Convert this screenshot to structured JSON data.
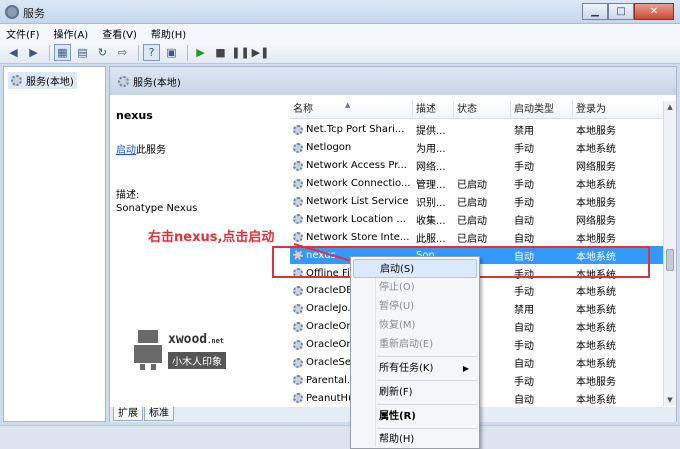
{
  "window": {
    "title": "服务",
    "min_glyph": "▁",
    "max_glyph": "□",
    "close_glyph": "✕"
  },
  "menu": [
    "文件(F)",
    "操作(A)",
    "查看(V)",
    "帮助(H)"
  ],
  "toolbar": {
    "icons": [
      "back-icon",
      "forward-icon",
      "console-tree-icon",
      "properties-icon",
      "refresh-icon",
      "export-icon",
      "help-icon",
      "view-icon",
      "start-icon",
      "stop-icon",
      "pause-icon",
      "restart-icon"
    ]
  },
  "tree": {
    "root": "服务(本地)"
  },
  "pane_header": "服务(本地)",
  "detail": {
    "service_name": "nexus",
    "action_link": "启动",
    "action_suffix": "此服务",
    "desc_label": "描述:",
    "desc_value": "Sonatype Nexus"
  },
  "columns": [
    "名称",
    "描述",
    "状态",
    "启动类型",
    "登录为"
  ],
  "rows": [
    {
      "name": "Net.Tcp Port Shari...",
      "desc": "提供...",
      "status": "",
      "start": "禁用",
      "logon": "本地服务"
    },
    {
      "name": "Netlogon",
      "desc": "为用...",
      "status": "",
      "start": "手动",
      "logon": "本地系统"
    },
    {
      "name": "Network Access Pr...",
      "desc": "网络...",
      "status": "",
      "start": "手动",
      "logon": "网络服务"
    },
    {
      "name": "Network Connectio...",
      "desc": "管理...",
      "status": "已启动",
      "start": "手动",
      "logon": "本地系统"
    },
    {
      "name": "Network List Service",
      "desc": "识别...",
      "status": "已启动",
      "start": "手动",
      "logon": "本地服务"
    },
    {
      "name": "Network Location ...",
      "desc": "收集...",
      "status": "已启动",
      "start": "自动",
      "logon": "网络服务"
    },
    {
      "name": "Network Store Inte...",
      "desc": "此服...",
      "status": "已启动",
      "start": "自动",
      "logon": "本地服务"
    },
    {
      "name": "nexus",
      "desc": "Son...",
      "status": "",
      "start": "自动",
      "logon": "本地系统",
      "selected": true
    },
    {
      "name": "Offline Fil...",
      "desc": "",
      "status": "",
      "start": "手动",
      "logon": "本地系统"
    },
    {
      "name": "OracleDB...",
      "desc": "",
      "status": "",
      "start": "手动",
      "logon": "本地系统"
    },
    {
      "name": "OracleJo...",
      "desc": "",
      "status": "",
      "start": "禁用",
      "logon": "本地系统"
    },
    {
      "name": "OracleOr...",
      "desc": "",
      "status": "",
      "start": "自动",
      "logon": "本地系统"
    },
    {
      "name": "OracleOr...",
      "desc": "",
      "status": "",
      "start": "手动",
      "logon": "本地系统"
    },
    {
      "name": "OracleSe...",
      "desc": "",
      "status": "",
      "start": "自动",
      "logon": "本地系统"
    },
    {
      "name": "Parental...",
      "desc": "",
      "status": "",
      "start": "手动",
      "logon": "本地服务"
    },
    {
      "name": "PeanutHu...",
      "desc": "",
      "status": "",
      "start": "自动",
      "logon": "本地系统"
    }
  ],
  "tabs": [
    "扩展",
    "标准"
  ],
  "annotation": "右击nexus,点击启动",
  "context_menu": [
    {
      "label": "启动(S)",
      "state": "hover"
    },
    {
      "label": "停止(O)",
      "state": "disabled"
    },
    {
      "label": "暂停(U)",
      "state": "disabled"
    },
    {
      "label": "恢复(M)",
      "state": "disabled"
    },
    {
      "label": "重新启动(E)",
      "state": "disabled"
    },
    {
      "label": "所有任务(K)",
      "state": "normal",
      "submenu": "▶"
    },
    {
      "label": "刷新(F)",
      "state": "normal"
    },
    {
      "label": "属性(R)",
      "state": "bold"
    },
    {
      "label": "帮助(H)",
      "state": "normal"
    }
  ],
  "watermark": {
    "brand": "xwood",
    "brand_suffix": ".net",
    "sub": "小木人印象"
  },
  "colors": {
    "accent": "#3399ff",
    "annotation": "#e0323a",
    "link": "#1a55c9"
  }
}
